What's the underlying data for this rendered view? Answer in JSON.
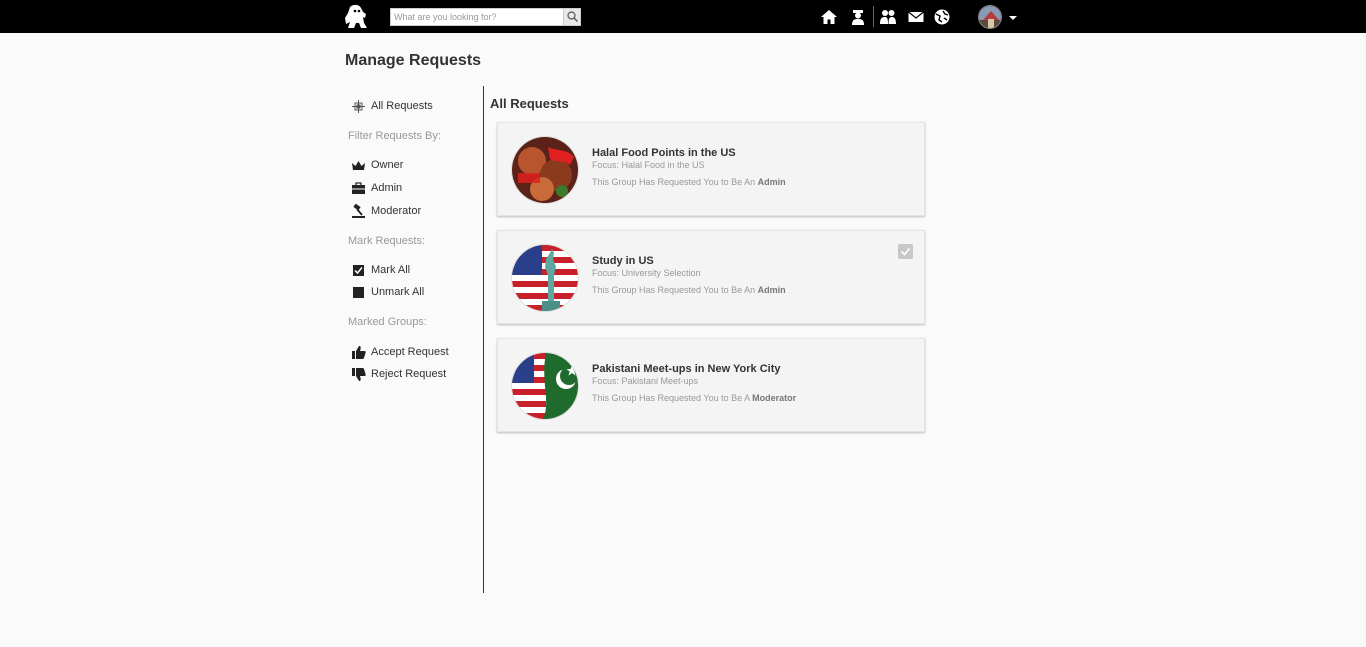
{
  "header": {
    "logo_icon": "gorilla-logo-icon",
    "search": {
      "placeholder": "What are you looking for?",
      "value": ""
    },
    "nav_icons": [
      "home-icon",
      "profile-icon",
      "friends-icon",
      "mail-icon",
      "globe-icon"
    ],
    "profile_menu_icon": "chevron-down-icon"
  },
  "page": {
    "title": "Manage Requests"
  },
  "sidebar": {
    "all_requests": "All Requests",
    "filter_heading": "Filter Requests By:",
    "filters": [
      {
        "label": "Owner",
        "icon": "crown-icon"
      },
      {
        "label": "Admin",
        "icon": "briefcase-icon"
      },
      {
        "label": "Moderator",
        "icon": "gavel-icon"
      }
    ],
    "mark_heading": "Mark Requests:",
    "marks": [
      {
        "label": "Mark All",
        "icon": "checked-box-icon"
      },
      {
        "label": "Unmark All",
        "icon": "unchecked-box-icon"
      }
    ],
    "marked_heading": "Marked Groups:",
    "actions": [
      {
        "label": "Accept Request",
        "icon": "thumbs-up-icon"
      },
      {
        "label": "Reject Request",
        "icon": "thumbs-down-icon"
      }
    ]
  },
  "main": {
    "section_title": "All Requests",
    "requests": [
      {
        "name": "Halal Food Points in the US",
        "focus": "Focus: Halal Food in the US",
        "text_prefix": "This Group Has Requested You to Be An",
        "role": "Admin",
        "marked": false
      },
      {
        "name": "Study in US",
        "focus": "Focus: University Selection",
        "text_prefix": "This Group Has Requested You to Be An",
        "role": "Admin",
        "marked": true
      },
      {
        "name": "Pakistani Meet-ups in New York City",
        "focus": "Focus: Pakistani Meet-ups",
        "text_prefix": "This Group Has Requested You to Be A",
        "role": "Moderator",
        "marked": false
      }
    ]
  }
}
